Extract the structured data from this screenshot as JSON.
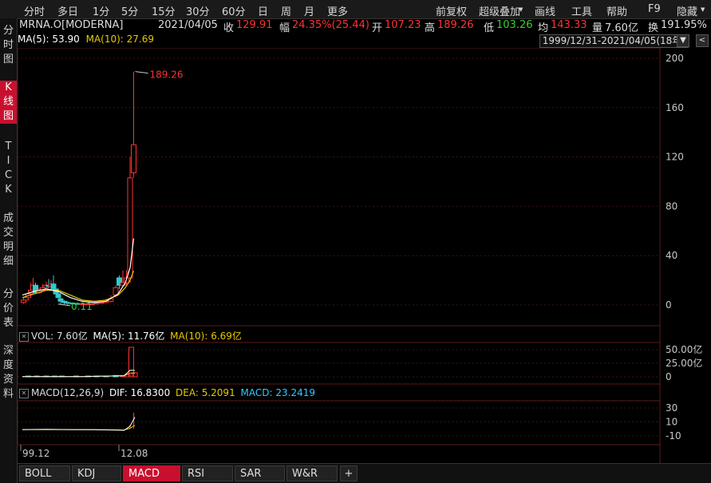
{
  "toolbar": {
    "left": [
      "分时",
      "多日",
      "1分",
      "5分",
      "15分",
      "30分",
      "60分",
      "日",
      "周",
      "月",
      "更多"
    ],
    "right": [
      "前复权",
      "超级叠加",
      "画线",
      "工具",
      "帮助",
      "F9",
      "隐藏"
    ]
  },
  "leftnav": [
    "分时图",
    "K线图",
    "TICK",
    "成交明细",
    "分价表",
    "深度资料"
  ],
  "info": {
    "symbol": "MRNA.O[MODERNA]",
    "date": "2021/04/05",
    "close_label": "收",
    "close": "129.91",
    "change_label": "幅",
    "change": "24.35%(25.44)",
    "open_label": "开",
    "open": "107.23",
    "high_label": "高",
    "high": "189.26",
    "low_label": "低",
    "low": "103.26",
    "avg_label": "均",
    "avg": "143.33",
    "vol_label": "量",
    "vol": "7.60亿",
    "turnover_label": "换",
    "turnover": "191.95%"
  },
  "ma": {
    "ma5": "MA(5): 53.90",
    "ma10": "MA(10): 27.69"
  },
  "date_range": "1999/12/31-2021/04/05(18年)",
  "buttons": {
    "range_dropdown": "▼",
    "panel_collapse": "<"
  },
  "price_axis": [
    "200",
    "160",
    "120",
    "80",
    "40",
    "0"
  ],
  "annotations": {
    "high": "189.26",
    "low": "0.11"
  },
  "vol_panel": {
    "label": "VOL: 7.60亿",
    "ma5": "MA(5): 11.76亿",
    "ma10": "MA(10): 6.69亿",
    "axis": [
      "50.00亿",
      "25.00亿",
      "0"
    ]
  },
  "macd_panel": {
    "label": "MACD(12,26,9)",
    "dif": "DIF: 16.8300",
    "dea": "DEA: 5.2091",
    "macd": "MACD: 23.2419",
    "axis": [
      "30",
      "10",
      "-10"
    ]
  },
  "date_axis": [
    "99.12",
    "12.08"
  ],
  "tabs": [
    "BOLL",
    "KDJ",
    "MACD",
    "RSI",
    "SAR",
    "W&R",
    "+"
  ],
  "colors": {
    "up": "#ff3232",
    "down": "#35c8c8",
    "ma5": "#ffffff",
    "ma10": "#e8c800",
    "accent": "#c8102e",
    "grid": "#3a1414"
  },
  "chart_data": {
    "type": "candlestick",
    "x_range": [
      "1999/12/31",
      "2021/04/05"
    ],
    "candles": [
      {
        "t": 0.01,
        "o": 2,
        "c": 4,
        "h": 6,
        "l": 1
      },
      {
        "t": 0.03,
        "o": 4,
        "c": 6,
        "h": 8,
        "l": 3
      },
      {
        "t": 0.05,
        "o": 6,
        "c": 9,
        "h": 11,
        "l": 5
      },
      {
        "t": 0.07,
        "o": 9,
        "c": 12,
        "h": 18,
        "l": 8
      },
      {
        "t": 0.09,
        "o": 12,
        "c": 16,
        "h": 22,
        "l": 11
      },
      {
        "t": 0.11,
        "o": 16,
        "c": 10,
        "h": 18,
        "l": 9
      },
      {
        "t": 0.14,
        "o": 10,
        "c": 12,
        "h": 14,
        "l": 9
      },
      {
        "t": 0.17,
        "o": 12,
        "c": 14,
        "h": 17,
        "l": 11
      },
      {
        "t": 0.2,
        "o": 14,
        "c": 16,
        "h": 19,
        "l": 13
      },
      {
        "t": 0.22,
        "o": 16,
        "c": 15,
        "h": 21,
        "l": 14
      },
      {
        "t": 0.24,
        "o": 15,
        "c": 17,
        "h": 20,
        "l": 14
      },
      {
        "t": 0.26,
        "o": 17,
        "c": 13,
        "h": 24,
        "l": 12
      },
      {
        "t": 0.28,
        "o": 13,
        "c": 9,
        "h": 15,
        "l": 6
      },
      {
        "t": 0.3,
        "o": 9,
        "c": 6,
        "h": 10,
        "l": 3
      },
      {
        "t": 0.32,
        "o": 5,
        "c": 3,
        "h": 6,
        "l": 1
      },
      {
        "t": 0.35,
        "o": 3,
        "c": 2,
        "h": 4,
        "l": 0.5
      },
      {
        "t": 0.38,
        "o": 2,
        "c": 1.5,
        "h": 3,
        "l": 0.11
      },
      {
        "t": 0.42,
        "o": 1.5,
        "c": 1.2,
        "h": 2,
        "l": 0.5
      },
      {
        "t": 0.46,
        "o": 1.2,
        "c": 1,
        "h": 2,
        "l": 0.5
      },
      {
        "t": 0.5,
        "o": 1,
        "c": 1,
        "h": 1.5,
        "l": 0.5
      },
      {
        "t": 0.54,
        "o": 1,
        "c": 1,
        "h": 1.5,
        "l": 0.5
      },
      {
        "t": 0.58,
        "o": 1,
        "c": 1,
        "h": 1.5,
        "l": 0.5
      },
      {
        "t": 0.62,
        "o": 1,
        "c": 1.5,
        "h": 2,
        "l": 0.5
      },
      {
        "t": 0.66,
        "o": 1.5,
        "c": 2,
        "h": 3,
        "l": 1
      },
      {
        "t": 0.7,
        "o": 2,
        "c": 3,
        "h": 5,
        "l": 1.5
      },
      {
        "t": 0.74,
        "o": 3,
        "c": 5,
        "h": 8,
        "l": 2
      },
      {
        "t": 0.78,
        "o": 8,
        "c": 14,
        "h": 16,
        "l": 6
      },
      {
        "t": 0.81,
        "o": 22,
        "c": 16,
        "h": 24,
        "l": 13
      },
      {
        "t": 0.84,
        "o": 16,
        "c": 18,
        "h": 28,
        "l": 15
      },
      {
        "t": 0.87,
        "o": 18,
        "c": 22,
        "h": 28,
        "l": 16
      },
      {
        "t": 0.9,
        "o": 22,
        "c": 103,
        "h": 120,
        "l": 18
      },
      {
        "t": 0.93,
        "o": 107.23,
        "c": 129.91,
        "h": 189.26,
        "l": 103.26
      }
    ],
    "ma5": [
      [
        0.0,
        8
      ],
      [
        0.1,
        11
      ],
      [
        0.2,
        13
      ],
      [
        0.3,
        11
      ],
      [
        0.4,
        6
      ],
      [
        0.5,
        3
      ],
      [
        0.6,
        2
      ],
      [
        0.7,
        3
      ],
      [
        0.8,
        9
      ],
      [
        0.86,
        18
      ],
      [
        0.9,
        30
      ],
      [
        0.93,
        53.9
      ]
    ],
    "ma10": [
      [
        0.0,
        6
      ],
      [
        0.1,
        9
      ],
      [
        0.2,
        12
      ],
      [
        0.3,
        12
      ],
      [
        0.4,
        8
      ],
      [
        0.5,
        4
      ],
      [
        0.6,
        3
      ],
      [
        0.7,
        4
      ],
      [
        0.8,
        8
      ],
      [
        0.86,
        14
      ],
      [
        0.9,
        20
      ],
      [
        0.93,
        27.69
      ]
    ],
    "volume": [
      [
        0.05,
        0.6
      ],
      [
        0.12,
        0.4
      ],
      [
        0.2,
        0.5
      ],
      [
        0.27,
        0.4
      ],
      [
        0.33,
        0.3
      ],
      [
        0.45,
        0.3
      ],
      [
        0.55,
        0.5
      ],
      [
        0.62,
        0.7
      ],
      [
        0.7,
        0.5
      ],
      [
        0.78,
        2.5
      ],
      [
        0.84,
        2.0
      ],
      [
        0.88,
        4.0
      ],
      [
        0.91,
        60
      ],
      [
        0.94,
        7.6
      ]
    ],
    "vol_ma5": [
      [
        0.0,
        0.5
      ],
      [
        0.5,
        0.5
      ],
      [
        0.85,
        2
      ],
      [
        0.9,
        12
      ],
      [
        0.94,
        11.76
      ]
    ],
    "vol_ma10": [
      [
        0.0,
        0.5
      ],
      [
        0.5,
        0.5
      ],
      [
        0.85,
        2
      ],
      [
        0.9,
        7
      ],
      [
        0.94,
        6.69
      ]
    ],
    "dif": [
      [
        0.0,
        -1
      ],
      [
        0.2,
        -0.5
      ],
      [
        0.4,
        -1
      ],
      [
        0.6,
        -1
      ],
      [
        0.75,
        -1.5
      ],
      [
        0.85,
        -2
      ],
      [
        0.9,
        4
      ],
      [
        0.94,
        16.83
      ]
    ],
    "dea": [
      [
        0.0,
        -1
      ],
      [
        0.2,
        -1
      ],
      [
        0.4,
        -1
      ],
      [
        0.6,
        -1.2
      ],
      [
        0.75,
        -1.3
      ],
      [
        0.85,
        -1.5
      ],
      [
        0.9,
        1
      ],
      [
        0.94,
        5.21
      ]
    ],
    "macd_bars": [
      [
        0.9,
        6
      ],
      [
        0.93,
        23.24
      ]
    ],
    "ylim": [
      -10,
      205
    ],
    "vol_ylim": [
      0,
      60
    ],
    "macd_ylim": [
      -15,
      35
    ]
  }
}
